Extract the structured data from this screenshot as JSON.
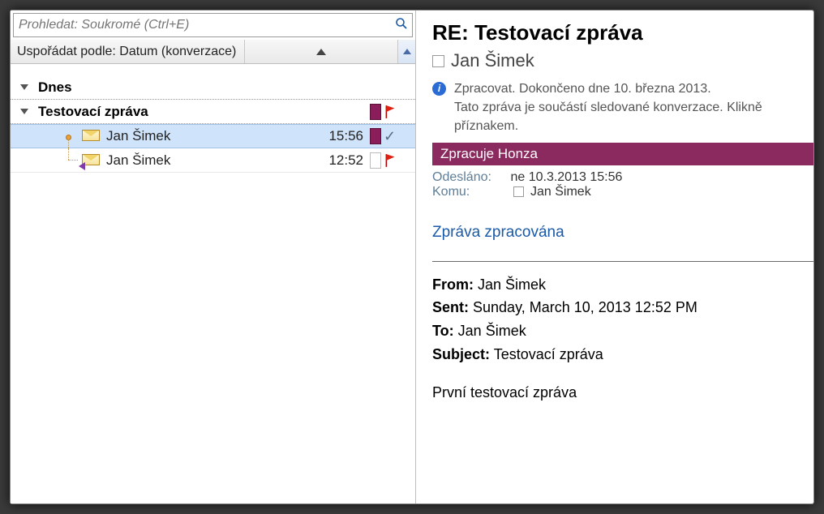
{
  "search": {
    "placeholder": "Prohledat: Soukromé (Ctrl+E)"
  },
  "sort": {
    "label": "Uspořádat podle: Datum (konverzace)"
  },
  "list": {
    "group_today": "Dnes",
    "conversation_subject": "Testovací zpráva",
    "messages": [
      {
        "sender": "Jan Šimek",
        "time": "15:56"
      },
      {
        "sender": "Jan Šimek",
        "time": "12:52"
      }
    ]
  },
  "reading": {
    "subject": "RE: Testovací zpráva",
    "from_display": "Jan Šimek",
    "followup_line1": "Zpracovat.  Dokončeno dne 10. března 2013.",
    "followup_line2": "Tato zpráva je součástí sledované konverzace. Klikně",
    "followup_line3": "příznakem.",
    "category_bar": "Zpracuje Honza",
    "sent_label": "Odesláno:",
    "sent_value": "ne 10.3.2013 15:56",
    "to_label": "Komu:",
    "to_value": "Jan Šimek",
    "body_link": "Zpráva zpracována",
    "orig_from_label": "From:",
    "orig_from_value": "Jan Šimek",
    "orig_sent_label": "Sent:",
    "orig_sent_value": "Sunday, March 10, 2013 12:52 PM",
    "orig_to_label": "To:",
    "orig_to_value": "Jan Šimek",
    "orig_subject_label": "Subject:",
    "orig_subject_value": "Testovací zpráva",
    "orig_body": "První testovací zpráva"
  }
}
